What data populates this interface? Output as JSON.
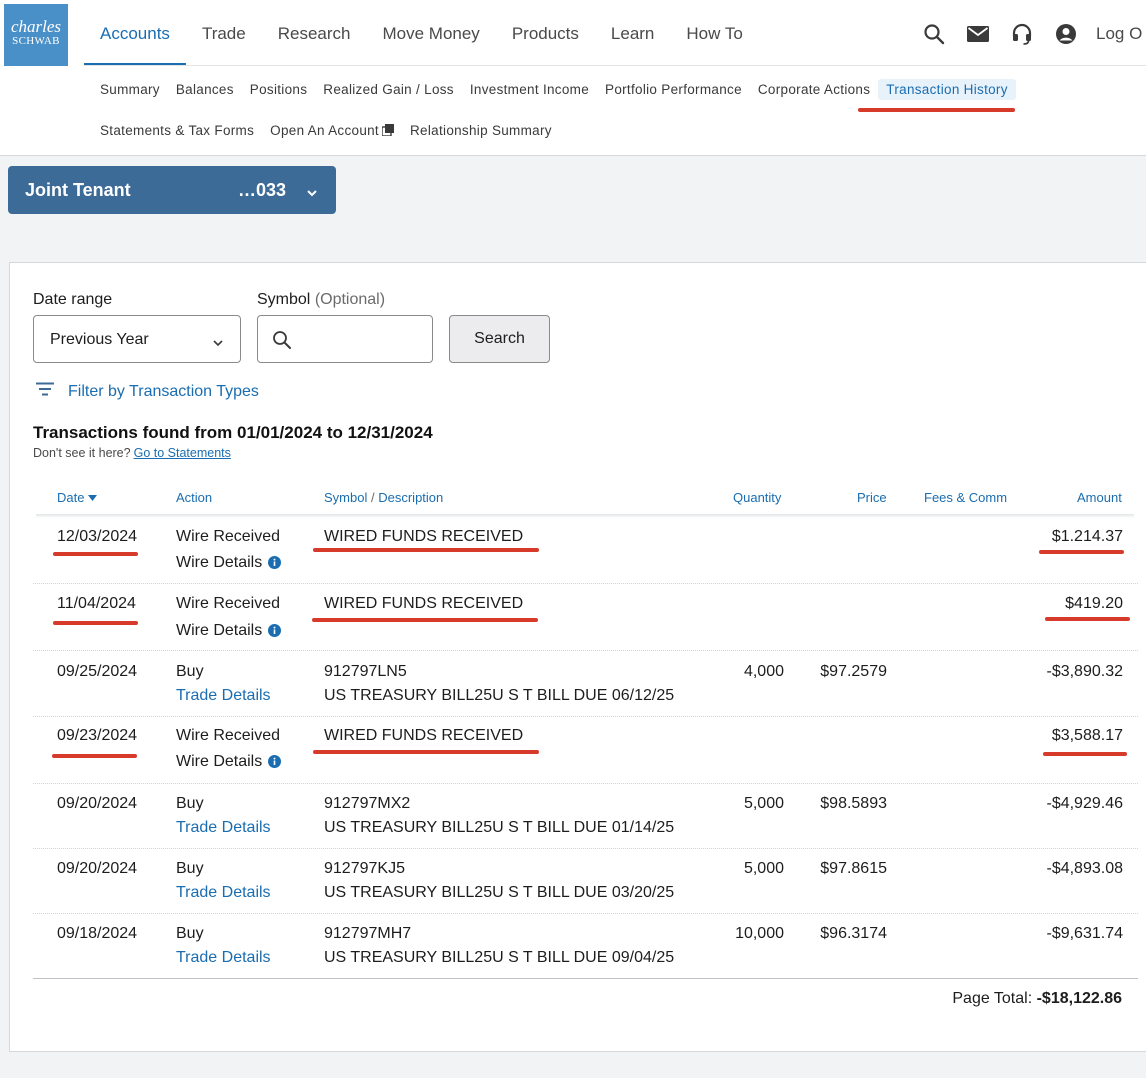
{
  "brand": {
    "line1": "charles",
    "line2": "SCHWAB"
  },
  "main_nav": [
    "Accounts",
    "Trade",
    "Research",
    "Move Money",
    "Products",
    "Learn",
    "How To"
  ],
  "header": {
    "logout_label": "Log O"
  },
  "sub_nav_row1": [
    "Summary",
    "Balances",
    "Positions",
    "Realized Gain / Loss",
    "Investment Income",
    "Portfolio Performance",
    "Corporate Actions",
    "Transaction History"
  ],
  "sub_nav_row2": [
    "Statements & Tax Forms",
    "Open An Account",
    "Relationship Summary"
  ],
  "account": {
    "name": "Joint Tenant",
    "number": "…033"
  },
  "filters": {
    "date_range_label": "Date range",
    "date_range_value": "Previous Year",
    "symbol_label": "Symbol",
    "symbol_optional": "(Optional)",
    "symbol_value": "",
    "search_label": "Search",
    "filter_types_label": "Filter by Transaction Types"
  },
  "summary": {
    "found_text": "Transactions found from 01/01/2024 to 12/31/2024",
    "dont_see": "Don't see it here?",
    "go_to_statements": "Go to Statements"
  },
  "table": {
    "headers": {
      "date": "Date",
      "action": "Action",
      "symbol": "Symbol",
      "slash": "/",
      "description": "Description",
      "quantity": "Quantity",
      "price": "Price",
      "fees": "Fees & Comm",
      "amount": "Amount"
    },
    "rows": [
      {
        "date": "12/03/2024",
        "action": "Wire Received",
        "details": "Wire Details",
        "symbol": "WIRED FUNDS RECEIVED",
        "description": "",
        "quantity": "",
        "price": "",
        "fees": "",
        "amount": "$1.214.37"
      },
      {
        "date": "11/04/2024",
        "action": "Wire Received",
        "details": "Wire Details",
        "symbol": "WIRED FUNDS RECEIVED",
        "description": "",
        "quantity": "",
        "price": "",
        "fees": "",
        "amount": "$419.20"
      },
      {
        "date": "09/25/2024",
        "action": "Buy",
        "details": "Trade Details",
        "symbol": "912797LN5",
        "description": "US TREASURY BILL25U S T BILL DUE 06/12/25",
        "quantity": "4,000",
        "price": "$97.2579",
        "fees": "",
        "amount": "-$3,890.32"
      },
      {
        "date": "09/23/2024",
        "action": "Wire Received",
        "details": "Wire Details",
        "symbol": "WIRED FUNDS RECEIVED",
        "description": "",
        "quantity": "",
        "price": "",
        "fees": "",
        "amount": "$3,588.17"
      },
      {
        "date": "09/20/2024",
        "action": "Buy",
        "details": "Trade Details",
        "symbol": "912797MX2",
        "description": "US TREASURY BILL25U S T BILL DUE 01/14/25",
        "quantity": "5,000",
        "price": "$98.5893",
        "fees": "",
        "amount": "-$4,929.46"
      },
      {
        "date": "09/20/2024",
        "action": "Buy",
        "details": "Trade Details",
        "symbol": "912797KJ5",
        "description": "US TREASURY BILL25U S T BILL DUE 03/20/25",
        "quantity": "5,000",
        "price": "$97.8615",
        "fees": "",
        "amount": "-$4,893.08"
      },
      {
        "date": "09/18/2024",
        "action": "Buy",
        "details": "Trade Details",
        "symbol": "912797MH7",
        "description": "US TREASURY BILL25U S T BILL DUE 09/04/25",
        "quantity": "10,000",
        "price": "$96.3174",
        "fees": "",
        "amount": "-$9,631.74"
      }
    ]
  },
  "page_total": {
    "label": "Page Total:",
    "value": "-$18,122.86"
  },
  "colors": {
    "accent": "#1a6db0",
    "account_bar": "#3c6b98",
    "logo": "#4a90c8",
    "annotation": "#d73a2a"
  }
}
